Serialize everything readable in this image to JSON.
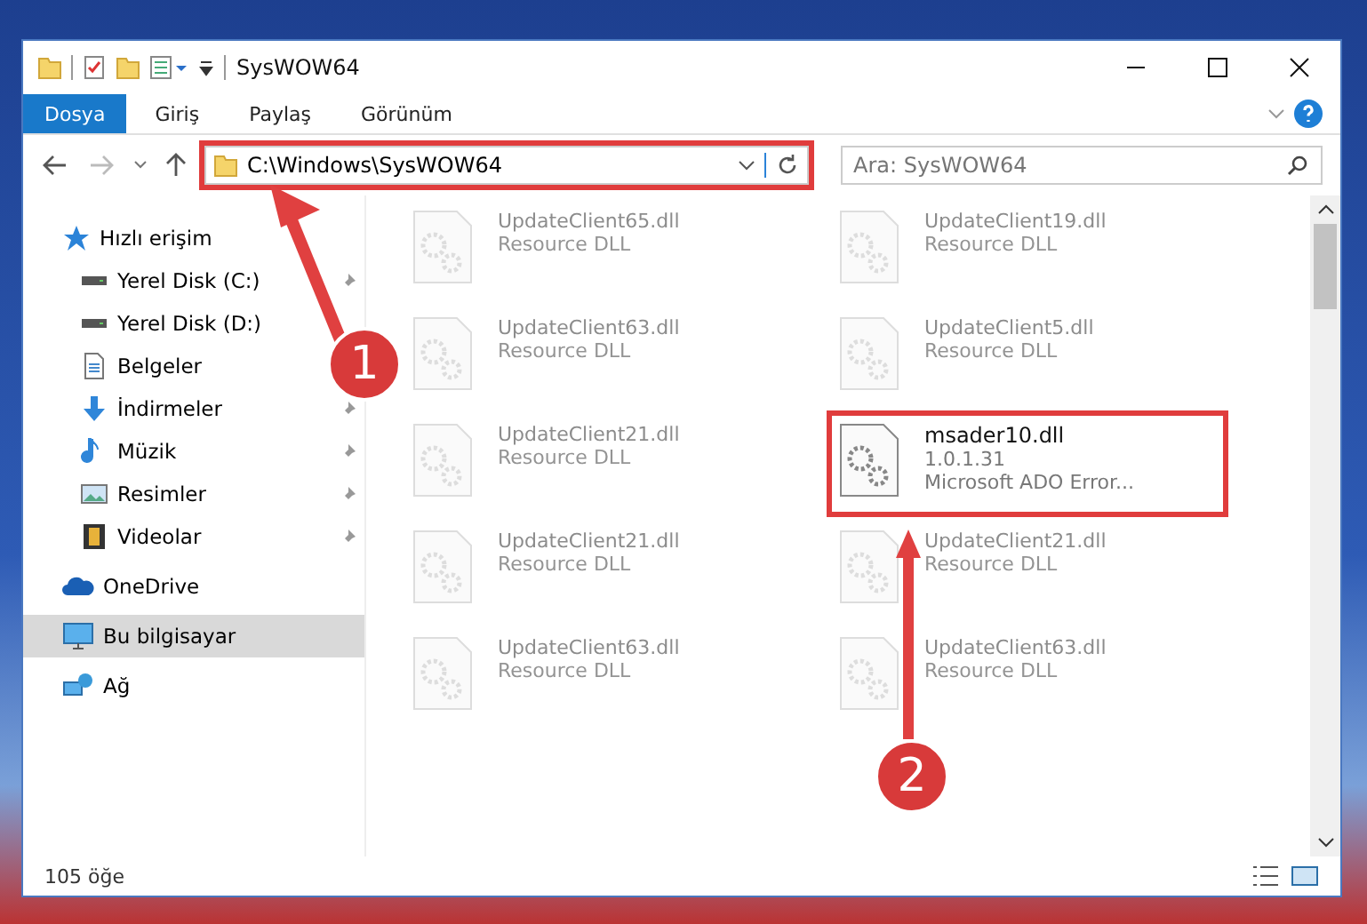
{
  "window": {
    "title": "SysWOW64"
  },
  "ribbon_tabs": [
    {
      "label": "Dosya",
      "kind": "file"
    },
    {
      "label": "Giriş",
      "kind": "tab"
    },
    {
      "label": "Paylaş",
      "kind": "tab"
    },
    {
      "label": "Görünüm",
      "kind": "tab"
    }
  ],
  "address_bar": {
    "path": "C:\\Windows\\SysWOW64",
    "highlighted": true
  },
  "search": {
    "placeholder": "Ara: SysWOW64"
  },
  "sidebar": {
    "items": [
      {
        "label": "Hızlı erişim",
        "kind": "star",
        "pinned": false,
        "selected": false,
        "group": true
      },
      {
        "label": "Yerel Disk (C:)",
        "kind": "disk",
        "pinned": true,
        "selected": false,
        "group": false
      },
      {
        "label": "Yerel Disk (D:)",
        "kind": "disk",
        "pinned": false,
        "selected": false,
        "group": false
      },
      {
        "label": "Belgeler",
        "kind": "doc",
        "pinned": false,
        "selected": false,
        "group": false
      },
      {
        "label": "İndirmeler",
        "kind": "download",
        "pinned": true,
        "selected": false,
        "group": false
      },
      {
        "label": "Müzik",
        "kind": "music",
        "pinned": true,
        "selected": false,
        "group": false
      },
      {
        "label": "Resimler",
        "kind": "picture",
        "pinned": true,
        "selected": false,
        "group": false
      },
      {
        "label": "Videolar",
        "kind": "video",
        "pinned": true,
        "selected": false,
        "group": false
      },
      {
        "label": "OneDrive",
        "kind": "cloud",
        "pinned": false,
        "selected": false,
        "group": true
      },
      {
        "label": "Bu bilgisayar",
        "kind": "pc",
        "pinned": false,
        "selected": true,
        "group": true
      },
      {
        "label": "Ağ",
        "kind": "network",
        "pinned": false,
        "selected": false,
        "group": true
      }
    ]
  },
  "files": [
    {
      "name": "UpdateClient65.dll",
      "lines": [
        "Resource DLL"
      ],
      "highlighted": false
    },
    {
      "name": "UpdateClient19.dll",
      "lines": [
        "Resource DLL"
      ],
      "highlighted": false
    },
    {
      "name": "UpdateClient63.dll",
      "lines": [
        "Resource DLL"
      ],
      "highlighted": false
    },
    {
      "name": "UpdateClient5.dll",
      "lines": [
        "Resource DLL"
      ],
      "highlighted": false
    },
    {
      "name": "UpdateClient21.dll",
      "lines": [
        "Resource DLL"
      ],
      "highlighted": false
    },
    {
      "name": "msader10.dll",
      "lines": [
        "1.0.1.31",
        "Microsoft ADO Error..."
      ],
      "highlighted": true
    },
    {
      "name": "UpdateClient21.dll",
      "lines": [
        "Resource DLL"
      ],
      "highlighted": false
    },
    {
      "name": "UpdateClient21.dll",
      "lines": [
        "Resource DLL"
      ],
      "highlighted": false
    },
    {
      "name": "UpdateClient63.dll",
      "lines": [
        "Resource DLL"
      ],
      "highlighted": false
    },
    {
      "name": "UpdateClient63.dll",
      "lines": [
        "Resource DLL"
      ],
      "highlighted": false
    }
  ],
  "status_bar": {
    "count": "105 öğe"
  },
  "annotations": [
    {
      "number": "1",
      "kind": "up-left"
    },
    {
      "number": "2",
      "kind": "up"
    }
  ]
}
